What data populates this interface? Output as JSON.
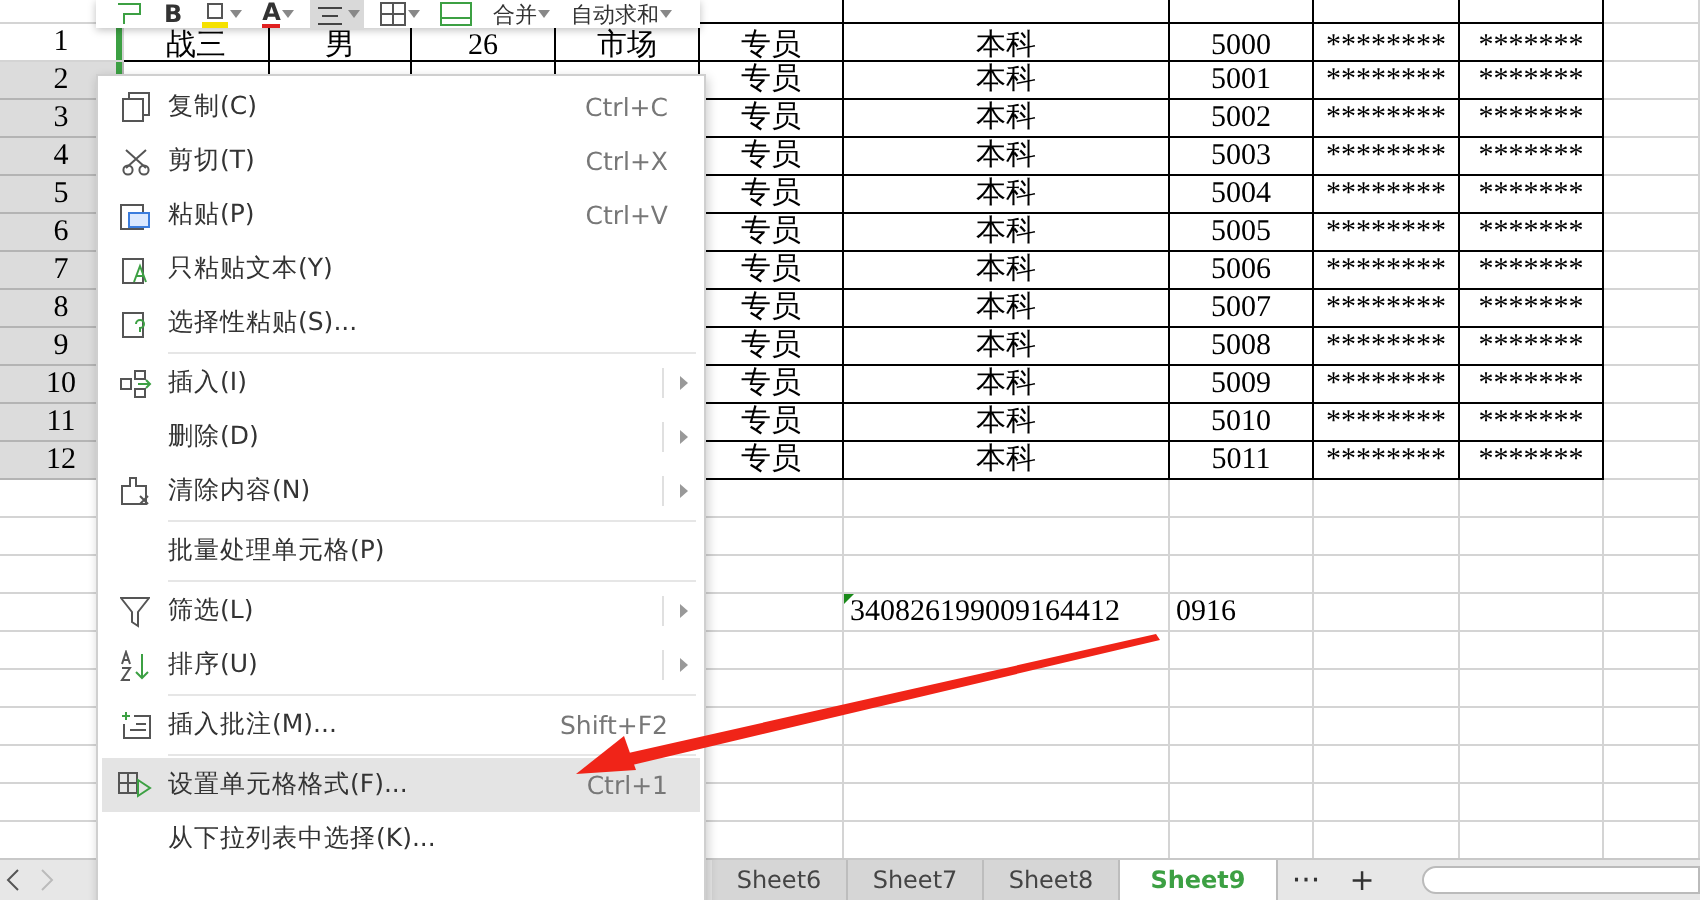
{
  "toolbar": {
    "bold": "B",
    "font_color": "A",
    "merge": "合并",
    "autosum": "自动求和"
  },
  "sheet": {
    "rows": [
      {
        "number": "1",
        "selected": false,
        "cells": [
          "战三",
          "男",
          "26",
          "市场",
          "专员",
          "本科",
          "5000",
          "********",
          "*******"
        ]
      },
      {
        "number": "2",
        "selected": true,
        "cells": [
          "",
          "",
          "",
          "",
          "专员",
          "本科",
          "5001",
          "********",
          "*******"
        ]
      },
      {
        "number": "3",
        "selected": true,
        "cells": [
          "",
          "",
          "",
          "",
          "专员",
          "本科",
          "5002",
          "********",
          "*******"
        ]
      },
      {
        "number": "4",
        "selected": true,
        "cells": [
          "",
          "",
          "",
          "",
          "专员",
          "本科",
          "5003",
          "********",
          "*******"
        ]
      },
      {
        "number": "5",
        "selected": true,
        "cells": [
          "",
          "",
          "",
          "",
          "专员",
          "本科",
          "5004",
          "********",
          "*******"
        ]
      },
      {
        "number": "6",
        "selected": true,
        "cells": [
          "",
          "",
          "",
          "",
          "专员",
          "本科",
          "5005",
          "********",
          "*******"
        ]
      },
      {
        "number": "7",
        "selected": true,
        "cells": [
          "",
          "",
          "",
          "",
          "专员",
          "本科",
          "5006",
          "********",
          "*******"
        ]
      },
      {
        "number": "8",
        "selected": true,
        "cells": [
          "",
          "",
          "",
          "",
          "专员",
          "本科",
          "5007",
          "********",
          "*******"
        ]
      },
      {
        "number": "9",
        "selected": true,
        "cells": [
          "",
          "",
          "",
          "",
          "专员",
          "本科",
          "5008",
          "********",
          "*******"
        ]
      },
      {
        "number": "10",
        "selected": true,
        "cells": [
          "",
          "",
          "",
          "",
          "专员",
          "本科",
          "5009",
          "********",
          "*******"
        ]
      },
      {
        "number": "11",
        "selected": true,
        "cells": [
          "",
          "",
          "",
          "",
          "专员",
          "本科",
          "5010",
          "********",
          "*******"
        ]
      },
      {
        "number": "12",
        "selected": true,
        "cells": [
          "",
          "",
          "",
          "",
          "专员",
          "本科",
          "5011",
          "********",
          "*******"
        ]
      }
    ],
    "loose_cells": [
      "340826199009164412",
      "0916"
    ]
  },
  "context_menu": [
    {
      "kind": "item",
      "label": "复制(C)",
      "shortcut": "Ctrl+C",
      "submenu": false,
      "selected": false
    },
    {
      "kind": "item",
      "label": "剪切(T)",
      "shortcut": "Ctrl+X",
      "submenu": false,
      "selected": false
    },
    {
      "kind": "item",
      "label": "粘贴(P)",
      "shortcut": "Ctrl+V",
      "submenu": false,
      "selected": false
    },
    {
      "kind": "item",
      "label": "只粘贴文本(Y)",
      "submenu": false,
      "selected": false
    },
    {
      "kind": "item",
      "label": "选择性粘贴(S)...",
      "submenu": false,
      "selected": false
    },
    {
      "kind": "separator"
    },
    {
      "kind": "item",
      "label": "插入(I)",
      "submenu": true,
      "selected": false
    },
    {
      "kind": "item",
      "label": "删除(D)",
      "submenu": true,
      "selected": false
    },
    {
      "kind": "item",
      "label": "清除内容(N)",
      "submenu": true,
      "selected": false
    },
    {
      "kind": "separator"
    },
    {
      "kind": "item",
      "label": "批量处理单元格(P)",
      "submenu": false,
      "selected": false
    },
    {
      "kind": "separator"
    },
    {
      "kind": "item",
      "label": "筛选(L)",
      "submenu": true,
      "selected": false
    },
    {
      "kind": "item",
      "label": "排序(U)",
      "submenu": true,
      "selected": false
    },
    {
      "kind": "separator"
    },
    {
      "kind": "item",
      "label": "插入批注(M)...",
      "shortcut": "Shift+F2",
      "submenu": false,
      "selected": false
    },
    {
      "kind": "separator"
    },
    {
      "kind": "item",
      "label": "设置单元格格式(F)...",
      "shortcut": "Ctrl+1",
      "submenu": false,
      "selected": true
    },
    {
      "kind": "item",
      "label": "从下拉列表中选择(K)...",
      "submenu": false,
      "selected": false
    }
  ],
  "sheet_tabs": {
    "tabs": [
      {
        "label": "Sheet6",
        "selected": false
      },
      {
        "label": "Sheet7",
        "selected": false
      },
      {
        "label": "Sheet8",
        "selected": false
      },
      {
        "label": "Sheet9",
        "selected": true
      }
    ],
    "more": "···",
    "add": "+"
  }
}
